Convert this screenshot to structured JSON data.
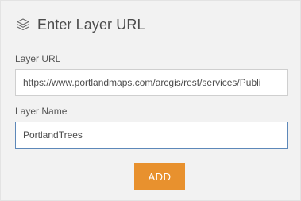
{
  "dialog": {
    "title": "Enter Layer URL",
    "title_icon": "layers-icon"
  },
  "fields": {
    "url": {
      "label": "Layer URL",
      "value": "https://www.portlandmaps.com/arcgis/rest/services/Publi"
    },
    "name": {
      "label": "Layer Name",
      "value": "PortlandTrees"
    }
  },
  "actions": {
    "add_label": "ADD"
  },
  "colors": {
    "accent": "#e8912e",
    "focus_border": "#5d88b9",
    "panel_bg": "#f2f2f2"
  }
}
